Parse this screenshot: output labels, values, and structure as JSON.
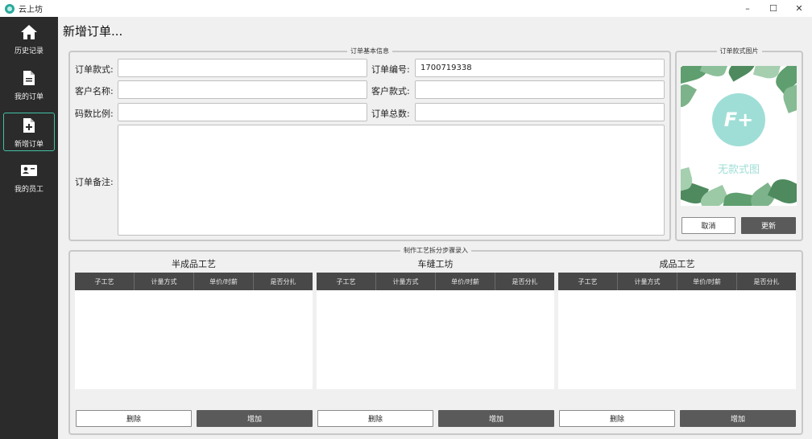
{
  "window": {
    "title": "云上坊",
    "minimize": "–",
    "maximize": "☐",
    "close": "✕"
  },
  "sidebar": {
    "items": [
      {
        "label": "历史记录",
        "icon": "home-icon"
      },
      {
        "label": "我的订单",
        "icon": "document-icon"
      },
      {
        "label": "新增订单",
        "icon": "add-document-icon",
        "active": true
      },
      {
        "label": "我的员工",
        "icon": "employee-card-icon"
      }
    ]
  },
  "page": {
    "title": "新增订单..."
  },
  "basic_info": {
    "legend": "订单基本信息",
    "style_label": "订单款式:",
    "style_value": "",
    "order_no_label": "订单编号:",
    "order_no_value": "1700719338",
    "customer_name_label": "客户名称:",
    "customer_name_value": "",
    "customer_style_label": "客户款式:",
    "customer_style_value": "",
    "size_ratio_label": "码数比例:",
    "size_ratio_value": "",
    "order_total_label": "订单总数:",
    "order_total_value": "",
    "remark_label": "订单备注:",
    "remark_value": ""
  },
  "style_image": {
    "legend": "订单款式图片",
    "logo_text": "F+",
    "caption": "无款式图",
    "cancel_label": "取消",
    "update_label": "更新"
  },
  "process": {
    "legend": "制作工艺拆分步骤录入",
    "columns": [
      "子工艺",
      "计量方式",
      "单价/时薪",
      "是否分扎"
    ],
    "sections": [
      {
        "title": "半成品工艺",
        "delete_label": "删除",
        "add_label": "增加"
      },
      {
        "title": "车缝工坊",
        "delete_label": "删除",
        "add_label": "增加"
      },
      {
        "title": "成品工艺",
        "delete_label": "删除",
        "add_label": "增加"
      }
    ]
  },
  "colors": {
    "accent": "#3fc2a6",
    "sidebar": "#2b2b2b",
    "header": "#484848",
    "dark_button": "#5a5a5a",
    "logo_teal": "#9fded6"
  }
}
